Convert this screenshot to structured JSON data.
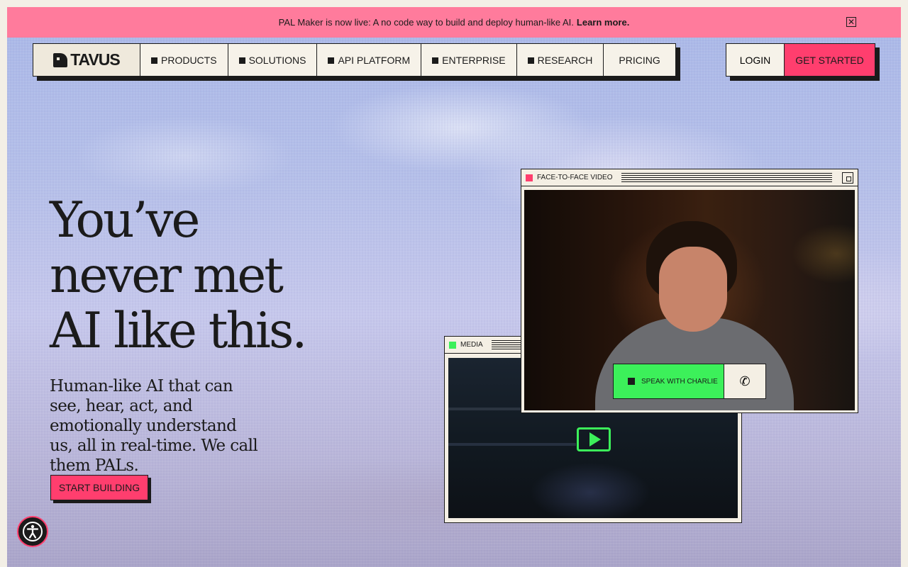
{
  "banner": {
    "text": "PAL Maker is now live: A no code way to build and deploy human-like AI.",
    "link": "Learn more.",
    "close_icon": "close-icon"
  },
  "nav": {
    "logo_text": "TAVUS",
    "items": [
      {
        "label": "PRODUCTS"
      },
      {
        "label": "SOLUTIONS"
      },
      {
        "label": "API PLATFORM"
      },
      {
        "label": "ENTERPRISE"
      },
      {
        "label": "RESEARCH"
      },
      {
        "label": "PRICING"
      }
    ]
  },
  "auth": {
    "login": "LOGIN",
    "get_started": "GET STARTED"
  },
  "hero": {
    "headline_line1": "You’ve",
    "headline_line2": "never met",
    "headline_line3": "AI like this.",
    "subtitle": "Human-like AI that can see, hear, act, and emotionally understand us, all in real-time. We call them PALs.",
    "cta": "START BUILDING"
  },
  "media_window": {
    "title": "MEDIA",
    "accent": "#3cf05a"
  },
  "ftf_window": {
    "title": "FACE-TO-FACE VIDEO",
    "accent": "#ff3e6e",
    "speak_label": "SPEAK WITH CHARLIE",
    "call_icon": "phone-icon"
  },
  "colors": {
    "banner": "#ff7b9c",
    "brand_pink": "#ff3e6e",
    "green": "#3cf05a",
    "ink": "#1b1b1b"
  }
}
